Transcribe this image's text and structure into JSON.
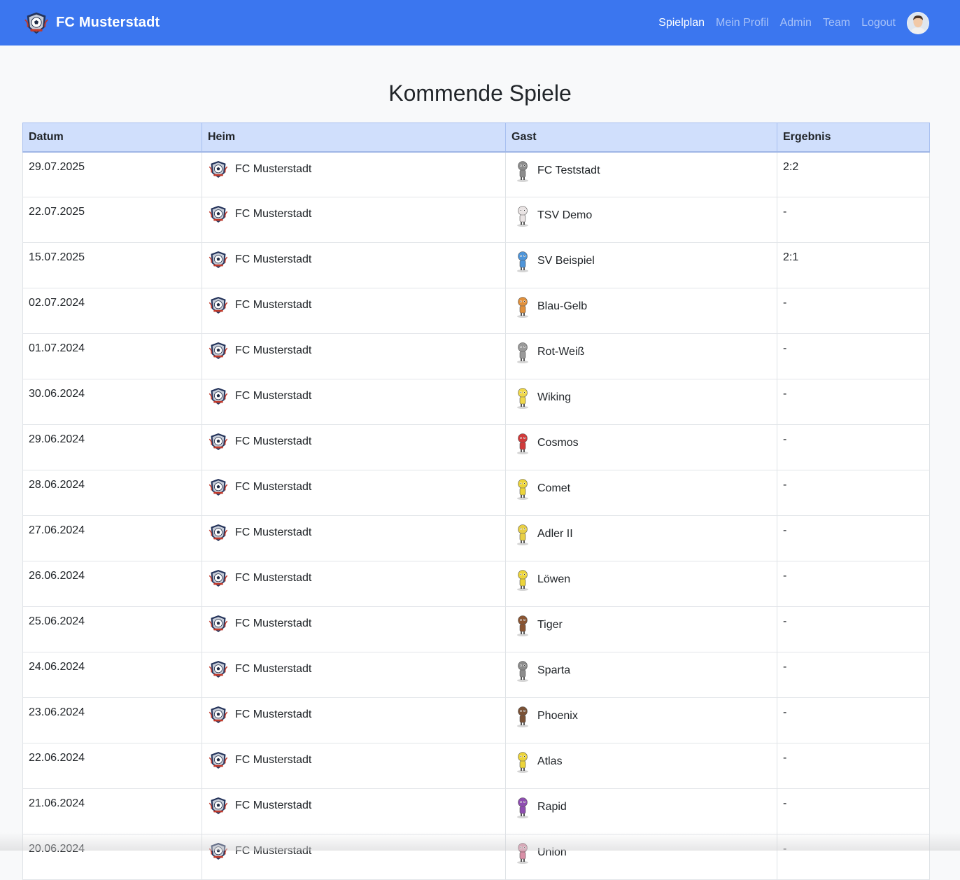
{
  "app": {
    "title": "FC Musterstadt"
  },
  "nav": {
    "items": [
      {
        "label": "Spielplan",
        "active": true
      },
      {
        "label": "Mein Profil",
        "active": false
      },
      {
        "label": "Admin",
        "active": false
      },
      {
        "label": "Team",
        "active": false
      },
      {
        "label": "Logout",
        "active": false
      }
    ],
    "avatar_icon": "user-avatar"
  },
  "page": {
    "title": "Kommende Spiele"
  },
  "colors": {
    "navbar": "#3b76ef",
    "header_row": "#d0dffc",
    "background": "#f8f9fa"
  },
  "table": {
    "headers": [
      "Datum",
      "Heim",
      "Gast",
      "Ergebnis"
    ],
    "rows": [
      {
        "date": "29.07.2025",
        "home": "FC Musterstadt",
        "guest": "FC Teststadt",
        "guest_color": "#8c8c8c",
        "result": "2:2"
      },
      {
        "date": "22.07.2025",
        "home": "FC Musterstadt",
        "guest": "TSV Demo",
        "guest_color": "#e9e3e3",
        "result": "-"
      },
      {
        "date": "15.07.2025",
        "home": "FC Musterstadt",
        "guest": "SV Beispiel",
        "guest_color": "#4f95d9",
        "result": "2:1"
      },
      {
        "date": "02.07.2024",
        "home": "FC Musterstadt",
        "guest": "Blau-Gelb",
        "guest_color": "#e0903c",
        "result": "-"
      },
      {
        "date": "01.07.2024",
        "home": "FC Musterstadt",
        "guest": "Rot-Weiß",
        "guest_color": "#9a9a9a",
        "result": "-"
      },
      {
        "date": "30.06.2024",
        "home": "FC Musterstadt",
        "guest": "Wiking",
        "guest_color": "#f0d84a",
        "result": "-"
      },
      {
        "date": "29.06.2024",
        "home": "FC Musterstadt",
        "guest": "Cosmos",
        "guest_color": "#d13a3a",
        "result": "-"
      },
      {
        "date": "28.06.2024",
        "home": "FC Musterstadt",
        "guest": "Comet",
        "guest_color": "#ecd43a",
        "result": "-"
      },
      {
        "date": "27.06.2024",
        "home": "FC Musterstadt",
        "guest": "Adler II",
        "guest_color": "#e8cf45",
        "result": "-"
      },
      {
        "date": "26.06.2024",
        "home": "FC Musterstadt",
        "guest": "Löwen",
        "guest_color": "#ecd43a",
        "result": "-"
      },
      {
        "date": "25.06.2024",
        "home": "FC Musterstadt",
        "guest": "Tiger",
        "guest_color": "#8a5532",
        "result": "-"
      },
      {
        "date": "24.06.2024",
        "home": "FC Musterstadt",
        "guest": "Sparta",
        "guest_color": "#8c8c8c",
        "result": "-"
      },
      {
        "date": "23.06.2024",
        "home": "FC Musterstadt",
        "guest": "Phoenix",
        "guest_color": "#7a5236",
        "result": "-"
      },
      {
        "date": "22.06.2024",
        "home": "FC Musterstadt",
        "guest": "Atlas",
        "guest_color": "#ecd43a",
        "result": "-"
      },
      {
        "date": "21.06.2024",
        "home": "FC Musterstadt",
        "guest": "Rapid",
        "guest_color": "#8e4db0",
        "result": "-"
      },
      {
        "date": "20.06.2024",
        "home": "FC Musterstadt",
        "guest": "Union",
        "guest_color": "#d98fa6",
        "result": "-"
      }
    ]
  }
}
